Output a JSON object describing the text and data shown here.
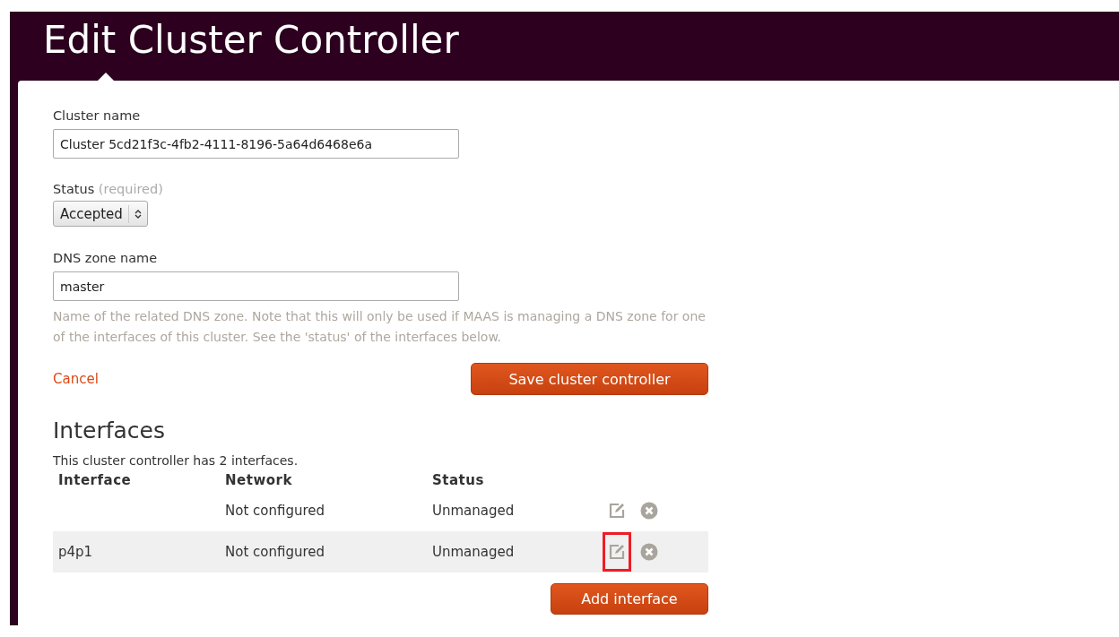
{
  "page": {
    "title": "Edit Cluster Controller"
  },
  "form": {
    "cluster_name": {
      "label": "Cluster name",
      "value": "Cluster 5cd21f3c-4fb2-4111-8196-5a64d6468e6a"
    },
    "status": {
      "label": "Status",
      "note": "(required)",
      "value": "Accepted"
    },
    "dns_zone": {
      "label": "DNS zone name",
      "value": "master",
      "help": "Name of the related DNS zone. Note that this will only be used if MAAS is managing a DNS zone for one of the interfaces of this cluster. See the 'status' of the interfaces below."
    },
    "cancel": "Cancel",
    "save": "Save cluster controller"
  },
  "interfaces": {
    "heading": "Interfaces",
    "summary": "This cluster controller has 2 interfaces.",
    "columns": [
      "Interface",
      "Network",
      "Status"
    ],
    "rows": [
      {
        "interface": "",
        "network": "Not configured",
        "status": "Unmanaged",
        "shaded": false,
        "edit_highlighted": false
      },
      {
        "interface": "p4p1",
        "network": "Not configured",
        "status": "Unmanaged",
        "shaded": true,
        "edit_highlighted": true
      }
    ],
    "add": "Add interface"
  }
}
